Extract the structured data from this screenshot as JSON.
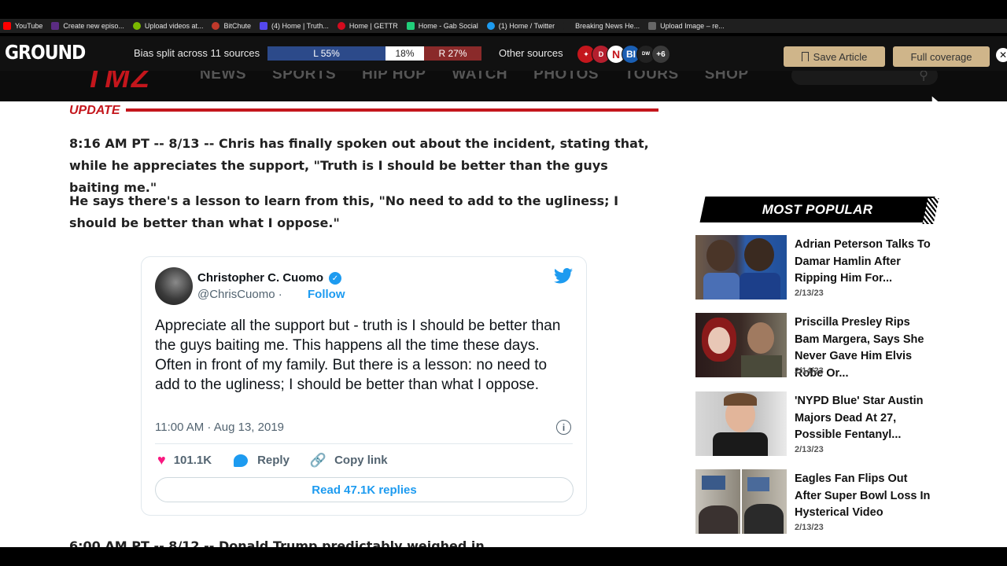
{
  "bookmarks": [
    {
      "label": "YouTube",
      "color": "#ff0000"
    },
    {
      "label": "Create new episo...",
      "color": "#5b2c83"
    },
    {
      "label": "Upload videos at...",
      "color": "#7ab800"
    },
    {
      "label": "BitChute",
      "color": "#c0392b"
    },
    {
      "label": "(4) Home | Truth...",
      "color": "#5448ee"
    },
    {
      "label": "Home | GETTR",
      "color": "#d40b1e"
    },
    {
      "label": "Home - Gab Social",
      "color": "#21cf7a"
    },
    {
      "label": "(1) Home / Twitter",
      "color": "#1d9bf0"
    },
    {
      "label": "Breaking News He...",
      "color": "#1f1f1f"
    },
    {
      "label": "Upload Image – re...",
      "color": "#666666"
    }
  ],
  "ground": {
    "logo": "GROUND",
    "bias_label": "Bias split across 11 sources",
    "left": "L 55%",
    "center": "18%",
    "right": "R 27%",
    "other_label": "Other sources",
    "more_count": "+6",
    "save_label": "Save Article",
    "full_label": "Full coverage",
    "close": "✕"
  },
  "tmz": {
    "logo": "TMZ",
    "nav": [
      "NEWS",
      "SPORTS",
      "HIP HOP",
      "WATCH",
      "PHOTOS",
      "TOURS",
      "SHOP"
    ]
  },
  "article": {
    "update_label": "UPDATE",
    "para1_time": "8:16 AM PT",
    "para1_text": " -- 8/13 -- Chris has finally spoken out about the incident, stating that, while he appreciates the support, \"Truth is I should be better than the guys baiting me.\"",
    "para2_text": "He says there's a lesson to learn from this, \"No need to add to the ugliness; I should be better than what I oppose.\"",
    "cut_text": "6:00 AM PT -- 8/12 -- Donald Trump predictably weighed in ..."
  },
  "tweet": {
    "name": "Christopher C. Cuomo",
    "handle": "@ChrisCuomo ·",
    "follow": "Follow",
    "text": "Appreciate all the support but - truth is I should be better than the guys baiting me. This happens all the time these days. Often in front of my family. But there is a lesson: no need to add to the ugliness; I should be better than what I oppose.",
    "time": "11:00 AM · Aug 13, 2019",
    "likes": "101.1K",
    "reply": "Reply",
    "copy_link": "Copy link",
    "read_more": "Read 47.1K replies"
  },
  "sidebar": {
    "title": "MOST POPULAR",
    "stories": [
      {
        "title": "Adrian Peterson Talks To Damar Hamlin After Ripping Him For...",
        "date": "2/13/23"
      },
      {
        "title": "Priscilla Presley Rips Bam Margera, Says She Never Gave Him Elvis Robe Or...",
        "date": "2/14/23"
      },
      {
        "title": "'NYPD Blue' Star Austin Majors Dead At 27, Possible Fentanyl...",
        "date": "2/13/23"
      },
      {
        "title": "Eagles Fan Flips Out After Super Bowl Loss In Hysterical Video",
        "date": "2/13/23"
      }
    ]
  }
}
